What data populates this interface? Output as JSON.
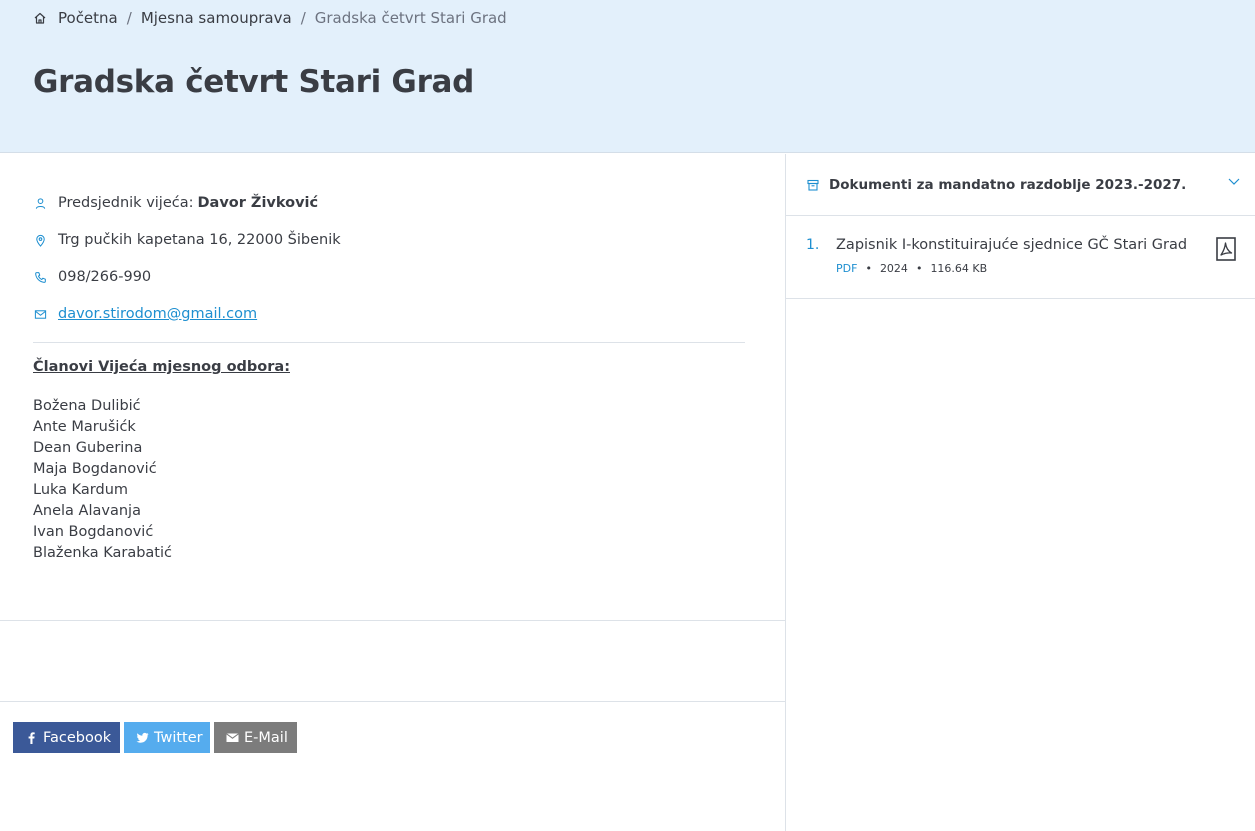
{
  "breadcrumb": {
    "home": "Početna",
    "level2": "Mjesna samouprava",
    "current": "Gradska četvrt Stari Grad",
    "separator": "/"
  },
  "page_title": "Gradska četvrt Stari Grad",
  "contact": {
    "president_label": "Predsjednik vijeća:",
    "president_name": "Davor Živković",
    "address": "Trg pučkih kapetana 16, 22000 Šibenik",
    "phone": "098/266-990",
    "email": "davor.stirodom@gmail.com"
  },
  "members": {
    "heading": "Članovi Vijeća mjesnog odbora:",
    "names": [
      "Božena Dulibić",
      "Ante Marušićk",
      "Dean Guberina",
      "Maja Bogdanović",
      "Luka Kardum",
      "Anela Alavanja",
      "Ivan Bogdanović",
      "Blaženka Karabatić"
    ]
  },
  "share": {
    "facebook": "Facebook",
    "twitter": "Twitter",
    "email": "E-Mail"
  },
  "documents": {
    "heading": "Dokumenti za mandatno razdoblje 2023.-2027.",
    "items": [
      {
        "number": "1.",
        "title": "Zapisnik I-konstituirajuće sjednice GČ Stari Grad",
        "type": "PDF",
        "year": "2024",
        "size": "116.64 KB"
      }
    ]
  },
  "colors": {
    "accent": "#1e8fd0",
    "hero_bg": "#e3f0fb",
    "facebook": "#3b5998",
    "twitter": "#55acee",
    "email": "#7c7c7c"
  }
}
